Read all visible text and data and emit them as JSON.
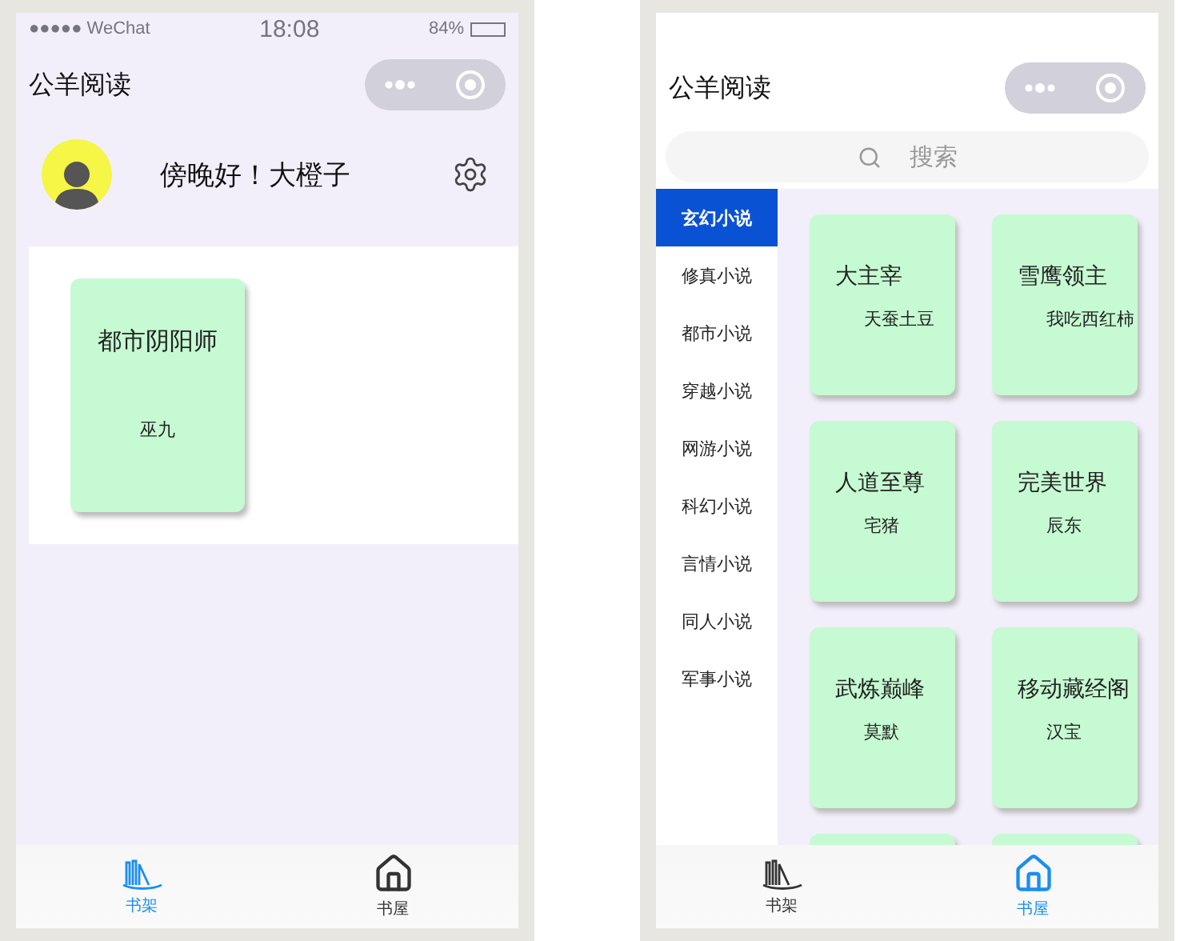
{
  "screens": [
    {
      "kind": "shelf",
      "status_bar": {
        "carrier": "●●●●● WeChat",
        "time": "18:08",
        "battery": "84%"
      },
      "title": "公羊阅读",
      "greeting": "傍晚好！大橙子",
      "books": [
        {
          "title": "都市阴阳师",
          "author": "巫九"
        }
      ],
      "tabbar": [
        {
          "kind": "shelf",
          "label": "书架",
          "selected": true
        },
        {
          "kind": "home",
          "label": "书屋",
          "selected": false
        }
      ]
    },
    {
      "kind": "store",
      "title": "公羊阅读",
      "search": {
        "placeholder": "搜索"
      },
      "categories": [
        {
          "label": "玄幻小说",
          "selected": true
        },
        {
          "label": "修真小说",
          "selected": false
        },
        {
          "label": "都市小说",
          "selected": false
        },
        {
          "label": "穿越小说",
          "selected": false
        },
        {
          "label": "网游小说",
          "selected": false
        },
        {
          "label": "科幻小说",
          "selected": false
        },
        {
          "label": "言情小说",
          "selected": false
        },
        {
          "label": "同人小说",
          "selected": false
        },
        {
          "label": "军事小说",
          "selected": false
        }
      ],
      "books": [
        {
          "title": "大主宰",
          "author": "天蚕土豆"
        },
        {
          "title": "雪鹰领主",
          "author": "我吃西红柿"
        },
        {
          "title": "人道至尊",
          "author": "宅猪"
        },
        {
          "title": "完美世界",
          "author": "辰东"
        },
        {
          "title": "武炼巅峰",
          "author": "莫默"
        },
        {
          "title": "移动藏经阁",
          "author": "汉宝"
        }
      ],
      "tabbar": [
        {
          "kind": "shelf",
          "label": "书架",
          "selected": false
        },
        {
          "kind": "home",
          "label": "书屋",
          "selected": true
        }
      ]
    }
  ]
}
